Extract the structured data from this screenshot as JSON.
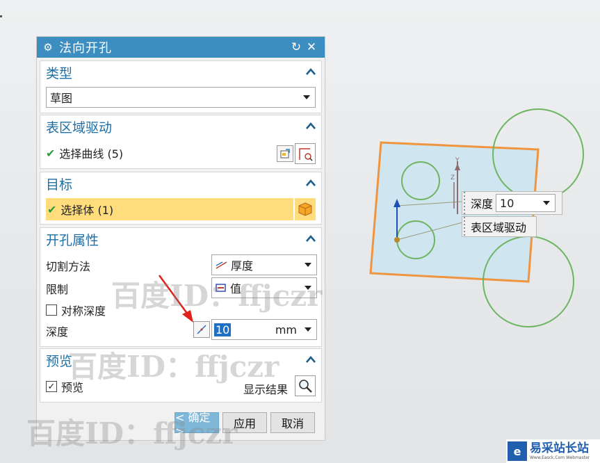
{
  "dialog": {
    "title": "法向开孔",
    "reset_symbol": "↻",
    "close_symbol": "✕",
    "gear_symbol": "⚙"
  },
  "type_section": {
    "label": "类型",
    "value": "草图"
  },
  "region_section": {
    "label": "表区域驱动",
    "select_curve": "选择曲线 (5)"
  },
  "target_section": {
    "label": "目标",
    "select_body": "选择体 (1)"
  },
  "hole_section": {
    "label": "开孔属性",
    "cut_method_label": "切割方法",
    "cut_method_value": "厚度",
    "limit_label": "限制",
    "limit_value": "值",
    "symmetric_label": "对称深度",
    "depth_label": "深度",
    "depth_value": "10",
    "depth_unit": "mm"
  },
  "preview_section": {
    "label": "预览",
    "preview_label": "预览",
    "show_result": "显示结果"
  },
  "buttons": {
    "ok": "< 确定 >",
    "apply": "应用",
    "cancel": "取消"
  },
  "viewport": {
    "depth_label": "深度",
    "depth_value": "10",
    "region_label": "表区域驱动",
    "axis_y": "Y",
    "axis_z": "Z"
  },
  "watermarks": [
    "百度ID：ffjczr",
    "百度ID：ffjczr",
    "百度ID：ffjczr"
  ],
  "logo": {
    "text": "易采站长站",
    "sub": "Www.Easck.Com Webmaster"
  },
  "colors": {
    "title_bar": "#3d8ec0",
    "section_header": "#1d6fa6",
    "selected_row": "#ffdc7c",
    "sheet_fill": "#cfe5ef",
    "sheet_border": "#f0953f",
    "circle": "#6db562"
  }
}
